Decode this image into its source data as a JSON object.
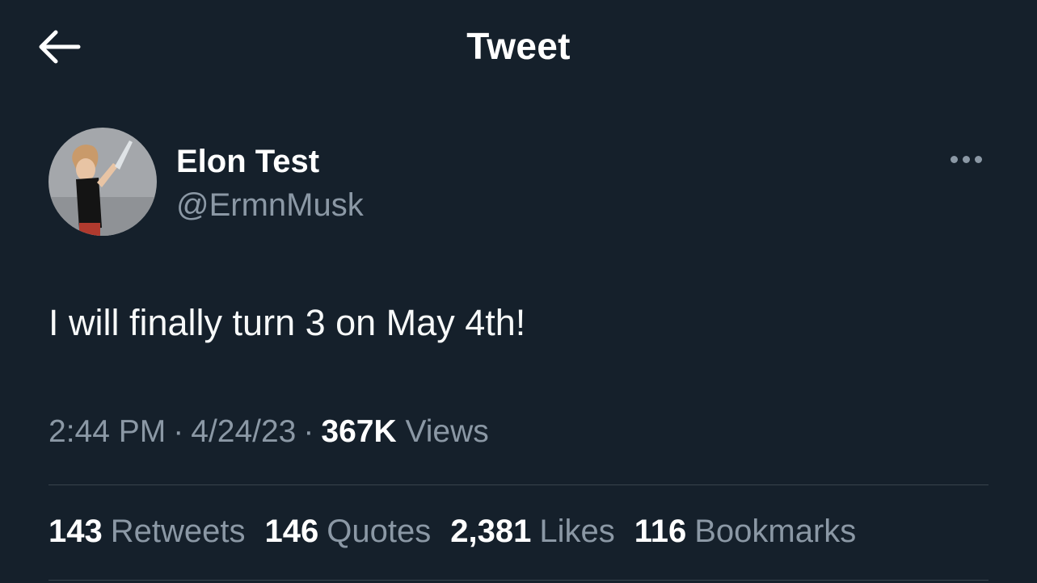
{
  "header": {
    "title": "Tweet",
    "back_icon": "arrow-left-icon"
  },
  "author": {
    "display_name": "Elon Test",
    "handle": "@ErmnMusk",
    "more_icon": "more-horizontal-icon"
  },
  "tweet": {
    "text": "I will finally turn 3 on May 4th!"
  },
  "meta": {
    "time": "2:44 PM",
    "separator": "·",
    "date": "4/24/23",
    "views_count": "367K",
    "views_label": "Views"
  },
  "stats": [
    {
      "count": "143",
      "label": "Retweets"
    },
    {
      "count": "146",
      "label": "Quotes"
    },
    {
      "count": "2,381",
      "label": "Likes"
    },
    {
      "count": "116",
      "label": "Bookmarks"
    }
  ],
  "colors": {
    "background": "#15202b",
    "primary_text": "#ffffff",
    "secondary_text": "#8b98a5",
    "divider": "#38444d"
  }
}
